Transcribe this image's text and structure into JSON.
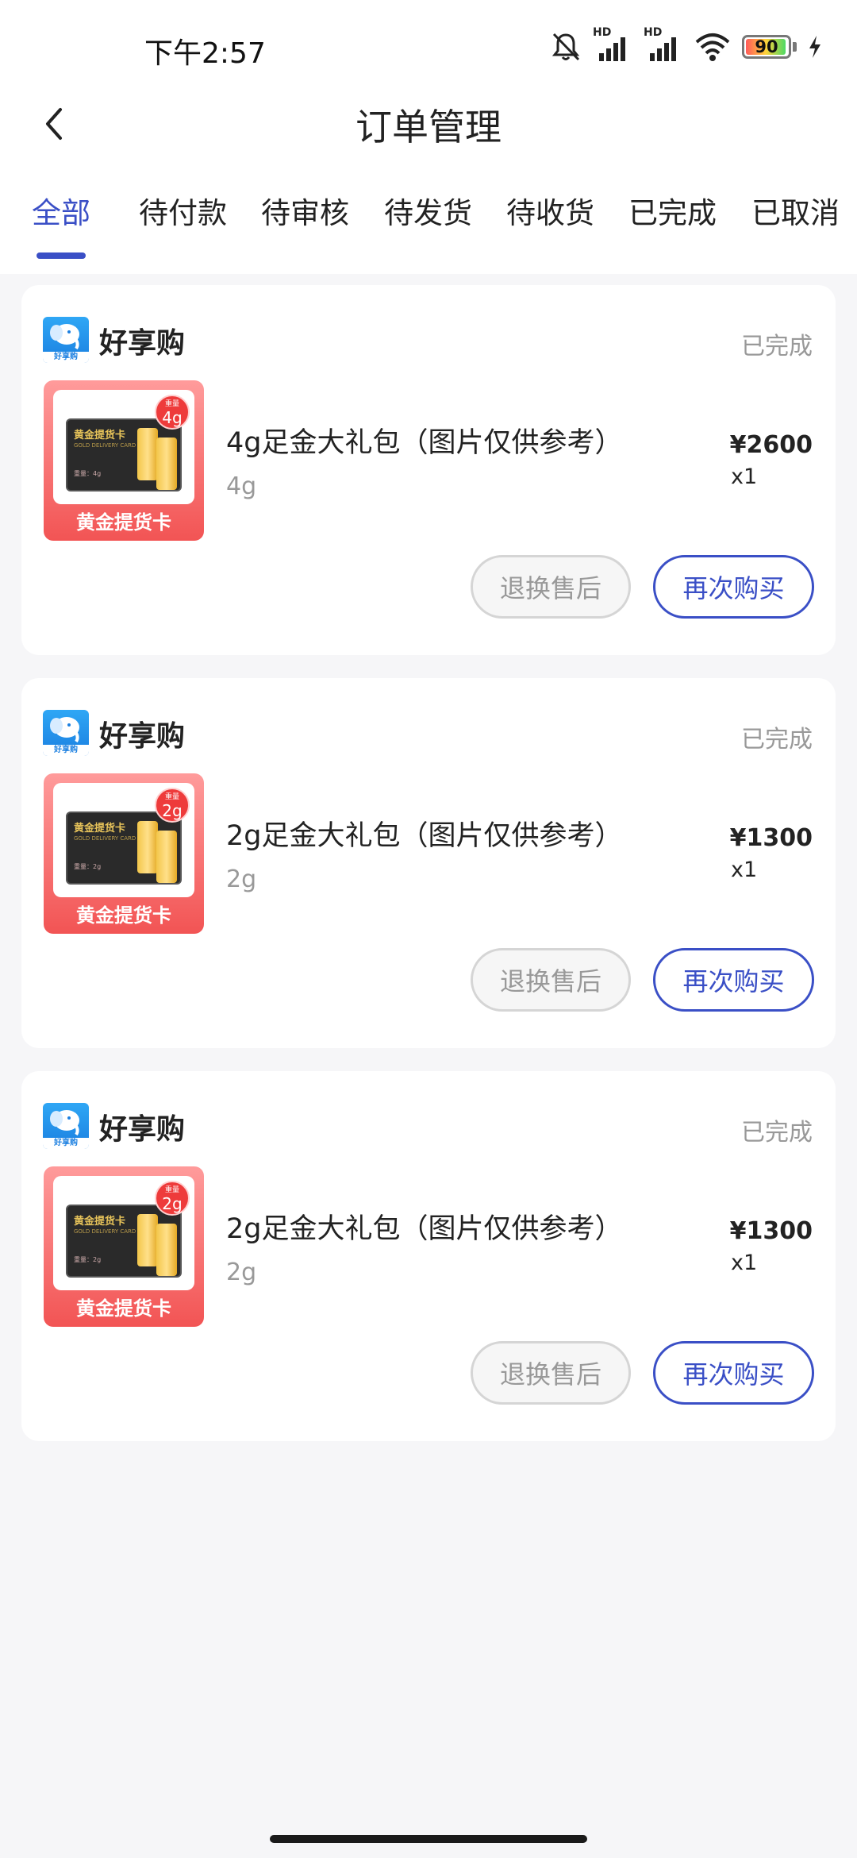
{
  "status_bar": {
    "time": "下午2:57",
    "signal_1_label": "HD",
    "signal_2_label": "HD",
    "battery_level": "90",
    "icons": [
      "mute-bell-icon",
      "signal-icon",
      "signal-icon",
      "wifi-icon",
      "battery-icon",
      "charging-icon"
    ]
  },
  "header": {
    "title": "订单管理",
    "back_icon": "chevron-left-icon"
  },
  "tabs": [
    {
      "label": "全部",
      "active": true
    },
    {
      "label": "待付款",
      "active": false
    },
    {
      "label": "待审核",
      "active": false
    },
    {
      "label": "待发货",
      "active": false
    },
    {
      "label": "待收货",
      "active": false
    },
    {
      "label": "已完成",
      "active": false
    },
    {
      "label": "已取消",
      "active": false
    }
  ],
  "orders": [
    {
      "shop_name": "好享购",
      "shop_logo_label": "好享购",
      "status": "已完成",
      "product": {
        "title": "4g足金大礼包（图片仅供参考）",
        "spec": "4g",
        "price": "¥2600",
        "quantity": "x1",
        "thumb_label": "黄金提货卡",
        "card_title": "黄金提货卡",
        "card_subtitle": "GOLD DELIVERY CARD",
        "card_weight_text": "重量：4g",
        "badge_top": "重量",
        "badge_value": "4g"
      },
      "buttons": {
        "aftersale": "退换售后",
        "rebuy": "再次购买"
      }
    },
    {
      "shop_name": "好享购",
      "shop_logo_label": "好享购",
      "status": "已完成",
      "product": {
        "title": "2g足金大礼包（图片仅供参考）",
        "spec": "2g",
        "price": "¥1300",
        "quantity": "x1",
        "thumb_label": "黄金提货卡",
        "card_title": "黄金提货卡",
        "card_subtitle": "GOLD DELIVERY CARD",
        "card_weight_text": "重量：2g",
        "badge_top": "重量",
        "badge_value": "2g"
      },
      "buttons": {
        "aftersale": "退换售后",
        "rebuy": "再次购买"
      }
    },
    {
      "shop_name": "好享购",
      "shop_logo_label": "好享购",
      "status": "已完成",
      "product": {
        "title": "2g足金大礼包（图片仅供参考）",
        "spec": "2g",
        "price": "¥1300",
        "quantity": "x1",
        "thumb_label": "黄金提货卡",
        "card_title": "黄金提货卡",
        "card_subtitle": "GOLD DELIVERY CARD",
        "card_weight_text": "重量：2g",
        "badge_top": "重量",
        "badge_value": "2g"
      },
      "buttons": {
        "aftersale": "退换售后",
        "rebuy": "再次购买"
      }
    }
  ],
  "colors": {
    "accent": "#3a4fc6",
    "page_background": "#f6f6f8",
    "muted_text": "#999999",
    "thumb_red": "#f25454"
  }
}
